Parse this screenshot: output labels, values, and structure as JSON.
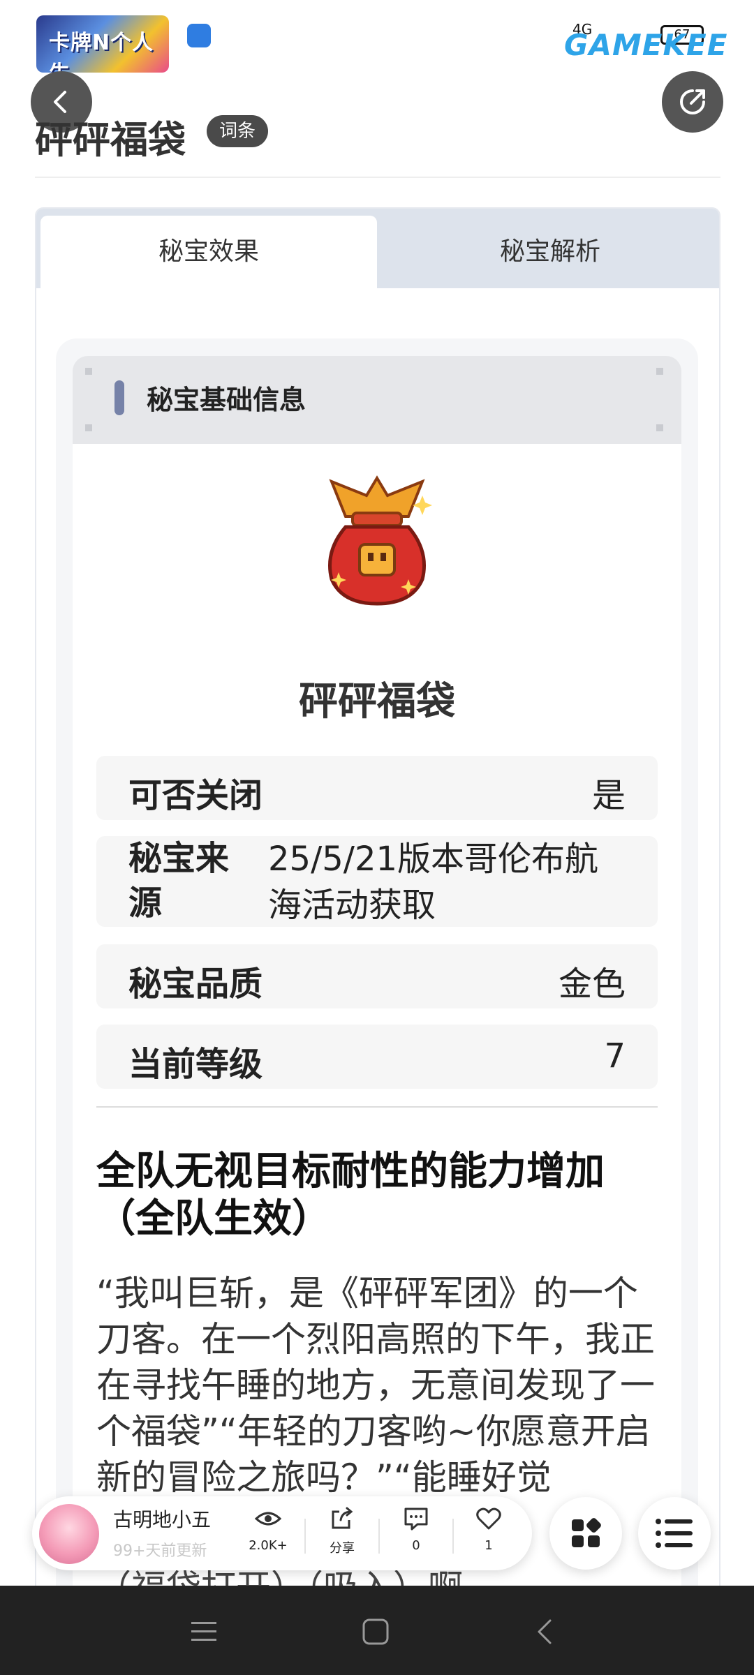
{
  "status_bar": {
    "game_logo_text": "卡牌N个人生",
    "network": "4G",
    "battery": "67",
    "site_logo": "GAMEKEE"
  },
  "header": {
    "title": "砰砰福袋",
    "tag": "词条"
  },
  "tabs": [
    {
      "label": "秘宝效果",
      "active": true
    },
    {
      "label": "秘宝解析",
      "active": false
    }
  ],
  "info": {
    "section_title": "秘宝基础信息",
    "item_name": "砰砰福袋",
    "rows": [
      {
        "key": "可否关闭",
        "value": "是"
      },
      {
        "key": "秘宝来源",
        "value": "25/5/21版本哥伦布航海活动获取"
      },
      {
        "key": "秘宝品质",
        "value": "金色"
      },
      {
        "key": "当前等级",
        "value": "7"
      }
    ]
  },
  "effect": {
    "title": "全队无视目标耐性的能力增加（全队生效）",
    "story": "“我叫巨斩，是《砰砰军团》的一个刀客。在一个烈阳高照的下午，我正在寻找午睡的地方，无意间发现了一个福袋”“年轻的刀客哟~你愿意开启新的冒险之旅吗？”“能睡好觉",
    "story_cut": "（福袋打开）（吸入）啊"
  },
  "bottom_bar": {
    "author": "古明地小五",
    "updated": "99+天前更新",
    "views": "2.0K+",
    "share_label": "分享",
    "comments": "0",
    "likes": "1"
  },
  "colors": {
    "tab_bg": "#dde3ec",
    "accent_bar": "#7682a8",
    "site_logo": "#2ea4e8"
  }
}
